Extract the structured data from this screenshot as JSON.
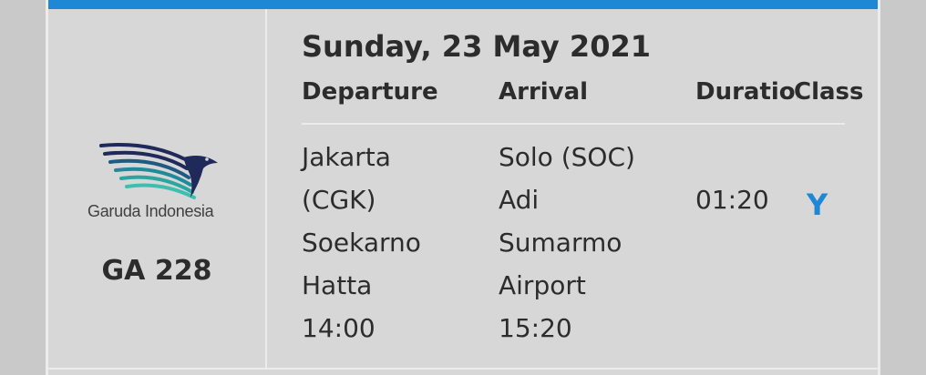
{
  "colors": {
    "accent": "#1e88d4",
    "card_background": "#d7d7d7",
    "text": "#2c2c2c"
  },
  "airline": {
    "logo_icon": "garuda-bird-logo",
    "logo_text": "Garuda Indonesia",
    "flight_number": "GA 228"
  },
  "itinerary": {
    "date": "Sunday, 23 May 2021",
    "headers": {
      "departure": "Departure",
      "arrival": "Arrival",
      "duration": "Duration",
      "class": "Class"
    },
    "departure": {
      "lines": [
        "Jakarta",
        "(CGK)",
        "Soekarno",
        "Hatta",
        "14:00"
      ]
    },
    "arrival": {
      "lines": [
        "Solo (SOC)",
        "Adi",
        "Sumarmo",
        "Airport",
        "15:20"
      ]
    },
    "duration": "01:20",
    "class": "Y"
  }
}
